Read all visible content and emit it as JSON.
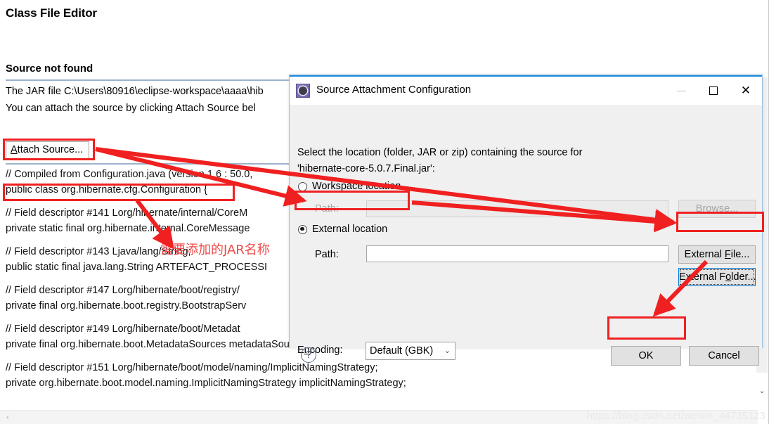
{
  "editor": {
    "page_title": "Class File Editor",
    "section_title": "Source not found",
    "message_line1": "The JAR file C:\\Users\\80916\\eclipse-workspace\\aaaa\\hib",
    "message_line2": "You can attach the source by clicking Attach Source bel",
    "attach_button": "Attach Source...",
    "attach_button_mnemonic": "A",
    "attach_button_rest": "ttach Source...",
    "code_lines": [
      "// Compiled from Configuration.java (version 1.6 : 50.0, ",
      "public class org.hibernate.cfg.Configuration {",
      "",
      "  // Field descriptor #141 Lorg/hibernate/internal/CoreM",
      "  private static final org.hibernate.internal.CoreMessage",
      "",
      "  // Field descriptor #143 Ljava/lang/String;",
      "  public static final java.lang.String ARTEFACT_PROCESSI",
      "",
      "  // Field descriptor #147 Lorg/hibernate/boot/registry/",
      "  private final org.hibernate.boot.registry.BootstrapServ",
      "",
      "  // Field descriptor #149 Lorg/hibernate/boot/Metadat",
      "  private final org.hibernate.boot.MetadataSources metadataSources;",
      "",
      "  // Field descriptor #151 Lorg/hibernate/boot/model/naming/ImplicitNamingStrategy;",
      "  private org.hibernate.boot.model.naming.ImplicitNamingStrategy implicitNamingStrategy;"
    ],
    "watermark": "https://blog.csdn.net/weixin_44735123",
    "scroll_left_arrow": "‹",
    "scroll_down_arrow": "⌄"
  },
  "annotation": {
    "chinese_note": "需要添加的JAR名称",
    "highlight_color": "#f02020"
  },
  "dialog": {
    "title": "Source Attachment Configuration",
    "icon": "gear-icon",
    "window_controls": {
      "minimize": "—",
      "maximize": "□",
      "close": "✕"
    },
    "description_line1": "Select the location (folder, JAR or zip) containing the source for",
    "description_line2": "'hibernate-core-5.0.7.Final.jar':",
    "workspace": {
      "radio_label": "Workspace location",
      "radio_mnemonic": "k",
      "selected": false,
      "path_label": "Path:",
      "path_value": "",
      "path_placeholder": "",
      "browse_button": "Browse...",
      "browse_mnemonic": "B"
    },
    "external": {
      "radio_label": "External location",
      "radio_mnemonic": "x",
      "selected": true,
      "path_label": "Path:",
      "path_value": "",
      "path_placeholder": "",
      "external_file_button": "External File...",
      "external_file_mnemonic": "F",
      "external_folder_button": "External Folder...",
      "external_folder_mnemonic": "o"
    },
    "encoding": {
      "label": "Encoding:",
      "label_mnemonic": "n",
      "selected_value": "Default (GBK)",
      "chevron": "⌄",
      "options": [
        "Default (GBK)"
      ]
    },
    "help_icon": "?",
    "ok_button": "OK",
    "cancel_button": "Cancel"
  }
}
